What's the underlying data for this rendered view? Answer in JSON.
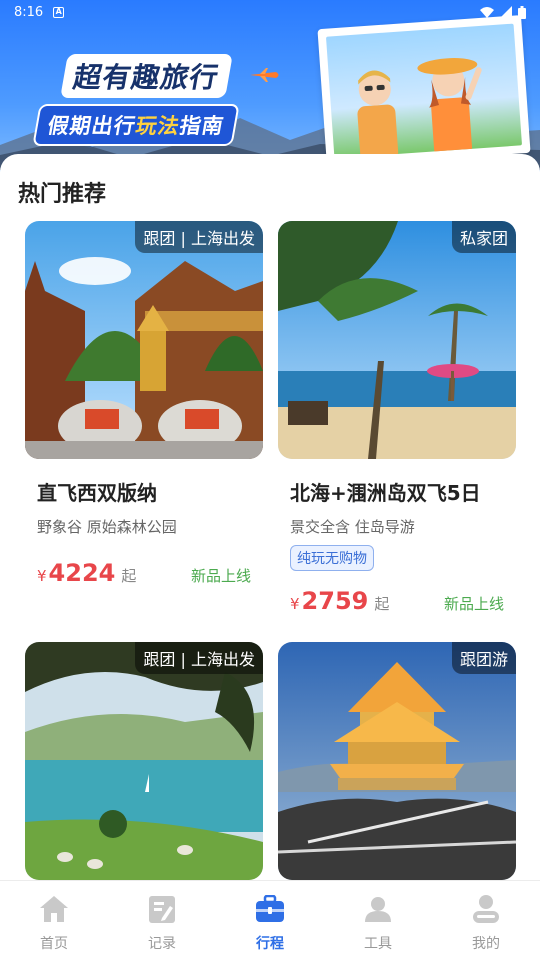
{
  "status_bar": {
    "time": "8:16"
  },
  "banner": {
    "title": "超有趣旅行",
    "subtitle_part1": "假期出行",
    "subtitle_highlight": "玩法",
    "subtitle_part2": "指南"
  },
  "section": {
    "title": "热门推荐"
  },
  "cards": [
    {
      "tag": "跟团 | 上海出发",
      "title": "直飞西双版纳",
      "subtitle": "野象谷 原始森林公园",
      "currency": "¥",
      "price": "4224",
      "price_suffix": "起",
      "badge": "新品上线"
    },
    {
      "tag": "私家团",
      "title": "北海+涠洲岛双飞5日",
      "subtitle": "景交全含 住岛导游",
      "pill": "纯玩无购物",
      "currency": "¥",
      "price": "2759",
      "price_suffix": "起",
      "badge": "新品上线"
    },
    {
      "tag": "跟团 | 上海出发"
    },
    {
      "tag": "跟团游"
    }
  ],
  "nav": {
    "items": [
      {
        "label": "首页",
        "icon": "home-icon",
        "active": false
      },
      {
        "label": "记录",
        "icon": "clipboard-icon",
        "active": false
      },
      {
        "label": "行程",
        "icon": "briefcase-icon",
        "active": true
      },
      {
        "label": "工具",
        "icon": "person-icon",
        "active": false
      },
      {
        "label": "我的",
        "icon": "profile-icon",
        "active": false
      }
    ]
  },
  "colors": {
    "accent": "#2f6fe6",
    "price": "#e8464a",
    "new_badge": "#4caa4f",
    "banner": "#2a7bff"
  }
}
